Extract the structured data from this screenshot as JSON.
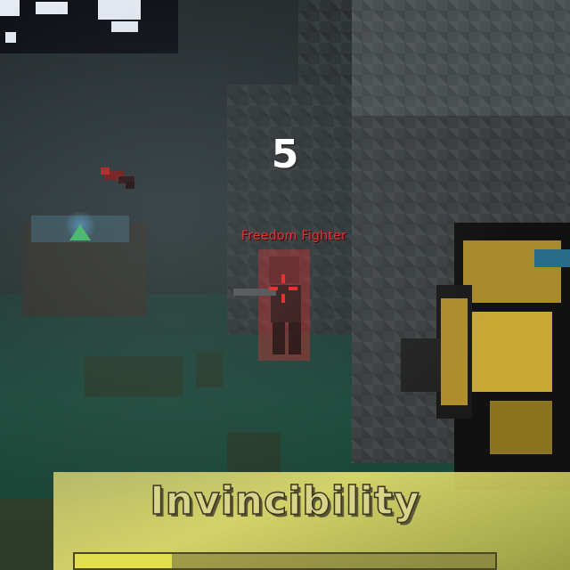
{
  "hud": {
    "counter": "5",
    "enemy_name": "Freedom Fighter",
    "status_label": "Invincibility",
    "status_progress": 0.23
  },
  "colors": {
    "enemy_name": "#e0343a",
    "crosshair": "#ff2020",
    "status_text": "#d8d48a",
    "status_bar": "#e2dd4c",
    "waypoint_marker": "#45c46b"
  },
  "icons": {
    "crosshair": "crosshair-icon",
    "waypoint": "arrow-marker-icon"
  }
}
